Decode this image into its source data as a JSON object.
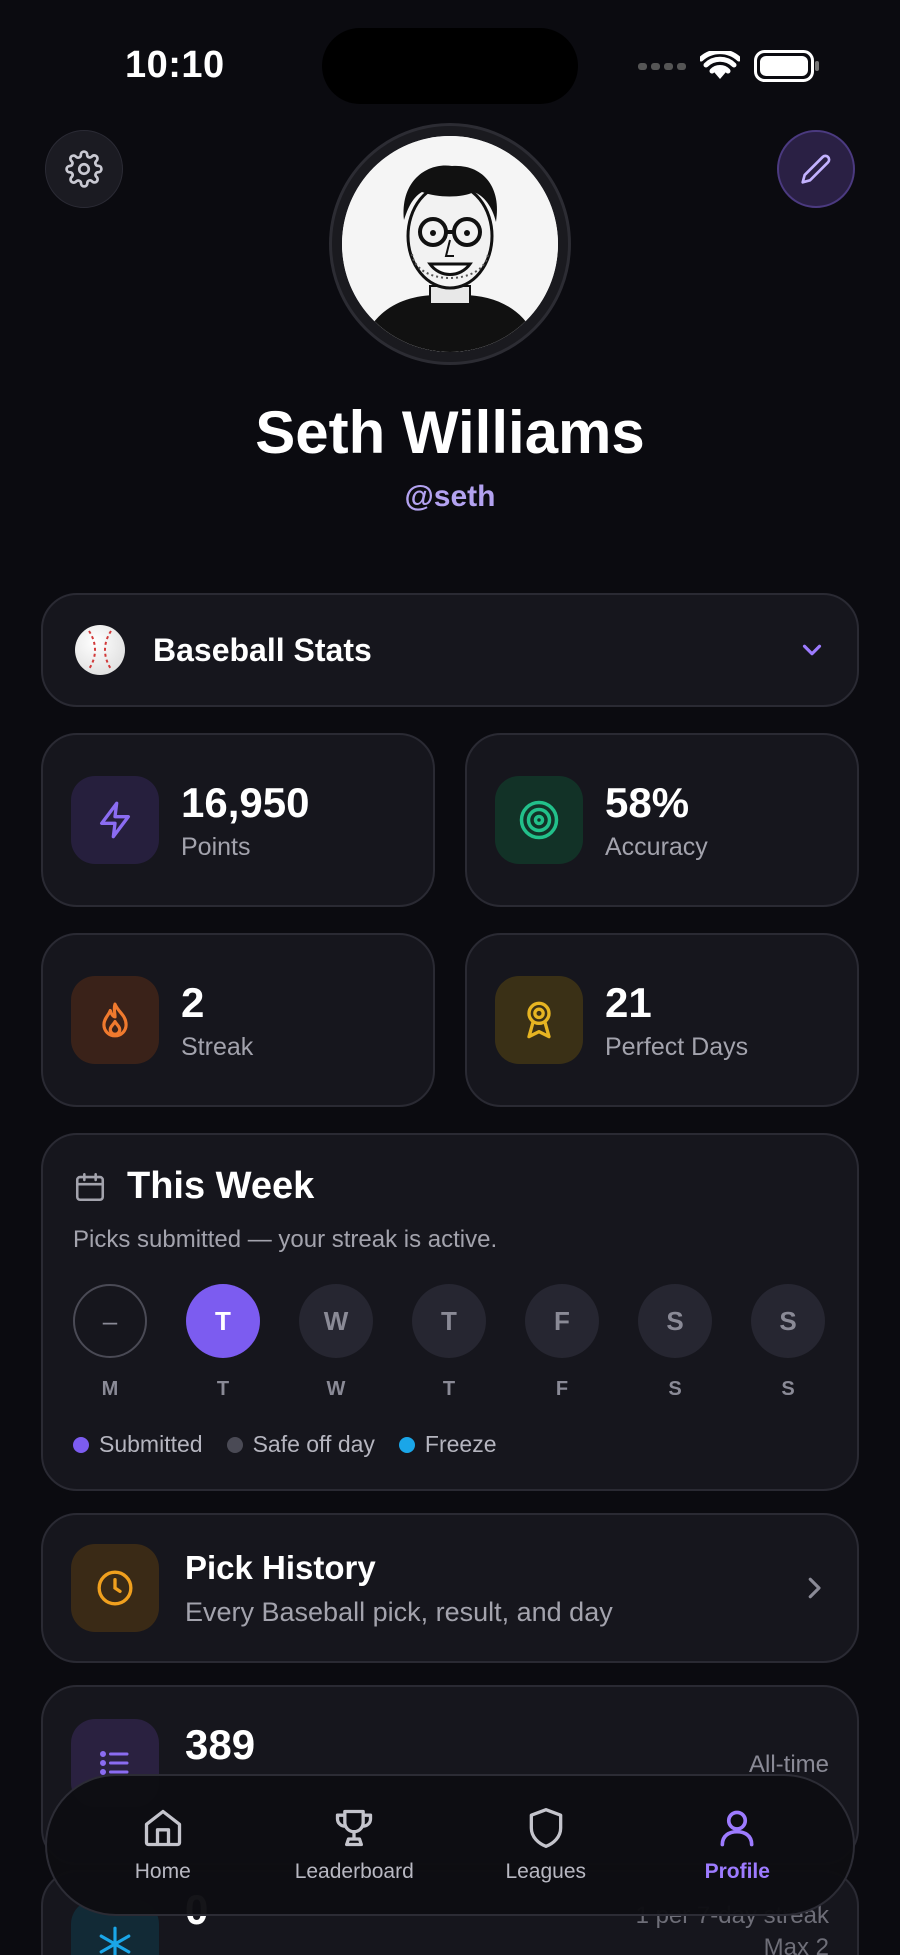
{
  "status_bar": {
    "time": "10:10"
  },
  "profile": {
    "name": "Seth Williams",
    "handle": "@seth"
  },
  "sport_selector": {
    "label": "Baseball Stats",
    "icon": "baseball-icon"
  },
  "stats": [
    {
      "value": "16,950",
      "label": "Points",
      "icon": "lightning-icon",
      "color": "#8b6cf2"
    },
    {
      "value": "58%",
      "label": "Accuracy",
      "icon": "target-icon",
      "color": "#22c08a"
    },
    {
      "value": "2",
      "label": "Streak",
      "icon": "flame-icon",
      "color": "#f07a2e"
    },
    {
      "value": "21",
      "label": "Perfect Days",
      "icon": "award-icon",
      "color": "#e6b422"
    }
  ],
  "week": {
    "title": "This Week",
    "subtitle": "Picks submitted — your streak is active.",
    "days": [
      {
        "symbol": "–",
        "letter": "M"
      },
      {
        "symbol": "T",
        "letter": "T"
      },
      {
        "symbol": "W",
        "letter": "W"
      },
      {
        "symbol": "T",
        "letter": "T"
      },
      {
        "symbol": "F",
        "letter": "F"
      },
      {
        "symbol": "S",
        "letter": "S"
      },
      {
        "symbol": "S",
        "letter": "S"
      }
    ],
    "legend": [
      {
        "label": "Submitted",
        "color": "#7c5cf0"
      },
      {
        "label": "Safe off day",
        "color": "#4a4a55"
      },
      {
        "label": "Freeze",
        "color": "#1aa6e8"
      }
    ]
  },
  "pick_history": {
    "title": "Pick History",
    "subtitle": "Every Baseball pick, result, and day"
  },
  "picks_count": {
    "value": "389",
    "note": "All-time"
  },
  "freezes": {
    "value": "0",
    "note1": "1 per 7-day streak",
    "note2": "Max 2"
  },
  "tabs": [
    {
      "label": "Home",
      "icon": "home-icon"
    },
    {
      "label": "Leaderboard",
      "icon": "trophy-icon"
    },
    {
      "label": "Leagues",
      "icon": "shield-icon"
    },
    {
      "label": "Profile",
      "icon": "user-icon",
      "active": true
    }
  ],
  "colors": {
    "accent": "#7c5cf0",
    "background": "#0b0b10",
    "card": "#16161d"
  }
}
